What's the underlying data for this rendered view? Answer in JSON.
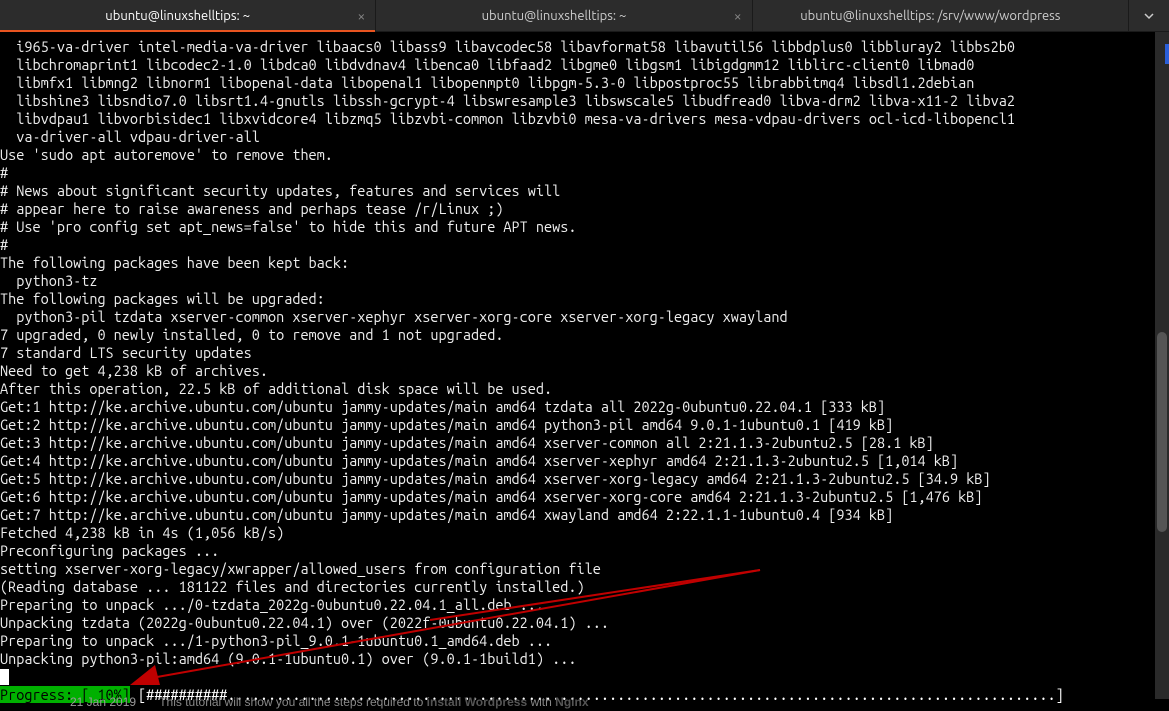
{
  "tabs": [
    {
      "title": "ubuntu@linuxshelltips: ~",
      "active": true
    },
    {
      "title": "ubuntu@linuxshelltips: ~",
      "active": false
    },
    {
      "title": "ubuntu@linuxshelltips: /srv/www/wordpress",
      "active": false
    }
  ],
  "lines": [
    "  i965-va-driver intel-media-va-driver libaacs0 libass9 libavcodec58 libavformat58 libavutil56 libbdplus0 libbluray2 libbs2b0",
    "  libchromaprint1 libcodec2-1.0 libdca0 libdvdnav4 libenca0 libfaad2 libgme0 libgsm1 libigdgmm12 liblirc-client0 libmad0",
    "  libmfx1 libmng2 libnorm1 libopenal-data libopenal1 libopenmpt0 libpgm-5.3-0 libpostproc55 librabbitmq4 libsdl1.2debian",
    "  libshine3 libsndio7.0 libsrt1.4-gnutls libssh-gcrypt-4 libswresample3 libswscale5 libudfread0 libva-drm2 libva-x11-2 libva2",
    "  libvdpau1 libvorbisidec1 libxvidcore4 libzmq5 libzvbi-common libzvbi0 mesa-va-drivers mesa-vdpau-drivers ocl-icd-libopencl1",
    "  va-driver-all vdpau-driver-all",
    "Use 'sudo apt autoremove' to remove them.",
    "#",
    "# News about significant security updates, features and services will",
    "# appear here to raise awareness and perhaps tease /r/Linux ;)",
    "# Use 'pro config set apt_news=false' to hide this and future APT news.",
    "#",
    "The following packages have been kept back:",
    "  python3-tz",
    "The following packages will be upgraded:",
    "  python3-pil tzdata xserver-common xserver-xephyr xserver-xorg-core xserver-xorg-legacy xwayland",
    "7 upgraded, 0 newly installed, 0 to remove and 1 not upgraded.",
    "7 standard LTS security updates",
    "Need to get 4,238 kB of archives.",
    "After this operation, 22.5 kB of additional disk space will be used.",
    "Get:1 http://ke.archive.ubuntu.com/ubuntu jammy-updates/main amd64 tzdata all 2022g-0ubuntu0.22.04.1 [333 kB]",
    "Get:2 http://ke.archive.ubuntu.com/ubuntu jammy-updates/main amd64 python3-pil amd64 9.0.1-1ubuntu0.1 [419 kB]",
    "Get:3 http://ke.archive.ubuntu.com/ubuntu jammy-updates/main amd64 xserver-common all 2:21.1.3-2ubuntu2.5 [28.1 kB]",
    "Get:4 http://ke.archive.ubuntu.com/ubuntu jammy-updates/main amd64 xserver-xephyr amd64 2:21.1.3-2ubuntu2.5 [1,014 kB]",
    "Get:5 http://ke.archive.ubuntu.com/ubuntu jammy-updates/main amd64 xserver-xorg-legacy amd64 2:21.1.3-2ubuntu2.5 [34.9 kB]",
    "Get:6 http://ke.archive.ubuntu.com/ubuntu jammy-updates/main amd64 xserver-xorg-core amd64 2:21.1.3-2ubuntu2.5 [1,476 kB]",
    "Get:7 http://ke.archive.ubuntu.com/ubuntu jammy-updates/main amd64 xwayland amd64 2:22.1.1-1ubuntu0.4 [934 kB]",
    "Fetched 4,238 kB in 4s (1,056 kB/s)",
    "Preconfiguring packages ...",
    "setting xserver-xorg-legacy/xwrapper/allowed_users from configuration file",
    "(Reading database ... 181122 files and directories currently installed.)",
    "Preparing to unpack .../0-tzdata_2022g-0ubuntu0.22.04.1_all.deb ...",
    "Unpacking tzdata (2022g-0ubuntu0.22.04.1) over (2022f-0ubuntu0.22.04.1) ...",
    "Preparing to unpack .../1-python3-pil_9.0.1-1ubuntu0.1_amd64.deb ...",
    "Unpacking python3-pil:amd64 (9.0.1-1ubuntu0.1) over (9.0.1-1build1) ..."
  ],
  "progress": {
    "label": "Progress: [ 10%]",
    "bar": " [##########......................................................................................................] "
  },
  "footer": {
    "date": "21 Jan 2019",
    "text_before": "This tutorial will show you all the steps required to ",
    "bold1": "install Wordpress",
    "mid": " with ",
    "bold2": "Nginx"
  }
}
